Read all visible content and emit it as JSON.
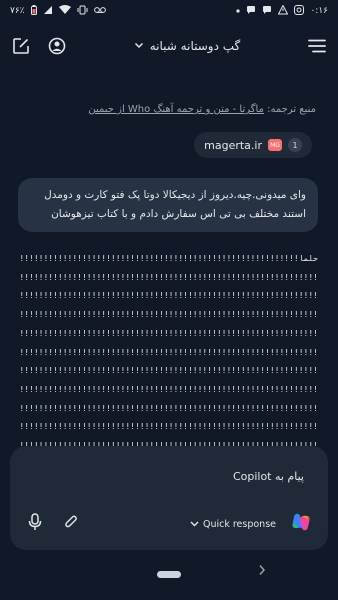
{
  "status_bar": {
    "time": "۰:۱۶",
    "battery": "۷۶٪",
    "left_icons": [
      "instagram-icon",
      "warning-icon",
      "chat-bubble-icon",
      "chat-bubble-icon",
      "dot-icon"
    ],
    "right_icons": [
      "voicemail-icon",
      "vibrate-icon",
      "wifi-icon",
      "signal-icon",
      "battery-icon"
    ]
  },
  "header": {
    "chat_title": "گپ دوستانه شبانه",
    "icons": [
      "menu-icon",
      "chevron-down-icon",
      "profile-icon",
      "new-chat-icon"
    ]
  },
  "source": {
    "prefix": "منبع ترجمه:",
    "link_text": "ماگرتا - متن و ترجمه آهنگ Who از جیمین"
  },
  "citation": {
    "number": "1",
    "site": "magerta.ir",
    "fav_text": "MG"
  },
  "user_message": {
    "line1": "وای میدونی.چیه.دیروز از دیجیکالا دوتا پک فتو کارت و دومدل",
    "line2": "استند مختلف بی تی اس سفارش دادم و با کتاب تیزهوشان"
  },
  "reply": {
    "first_line": "حلما!!!!!!!!!!!!!!!!!!!!!!!!!!!!!!!!!!!!!!!!!!!!!!!!!!!!!!!!!!!!!!!!!!!!!!!!!!!!!",
    "bang_line": "!!!!!!!!!!!!!!!!!!!!!!!!!!!!!!!!!!!!!!!!!!!!!!!!!!!!!!!!!!!!!!!!!!!!!!!!!!!!!!!!!!!!!!"
  },
  "composer": {
    "placeholder": "پیام به Copilot",
    "quick_response": "Quick response",
    "icons": [
      "microphone-icon",
      "attachment-icon",
      "chevron-down-icon",
      "copilot-logo-icon"
    ]
  },
  "nav": {
    "icons": [
      "home-pill-icon",
      "chevron-right-icon"
    ]
  }
}
